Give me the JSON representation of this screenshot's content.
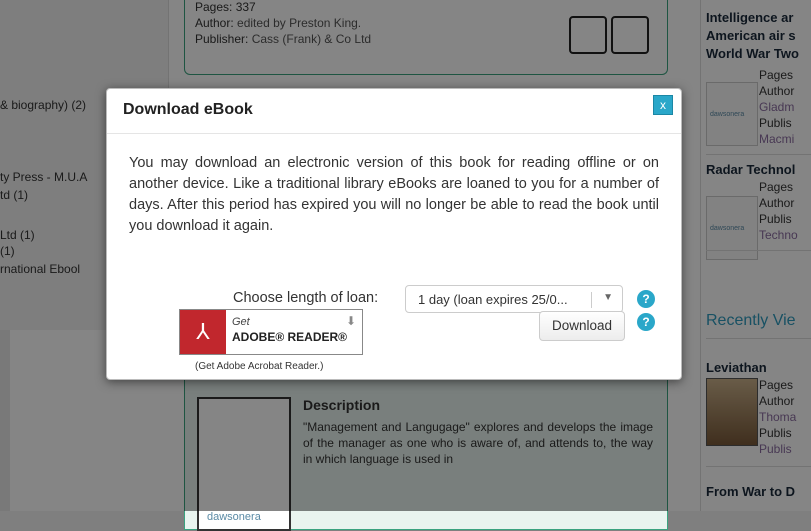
{
  "left_sidebar": {
    "items": [
      "& biography) (2)",
      "ty Press - M.U.A",
      "td (1)",
      "Ltd (1)",
      "(1)",
      "rnational Ebool"
    ]
  },
  "center_book": {
    "pages": "Pages: 337",
    "author_label": "Author:",
    "author": "edited by Preston King.",
    "publisher_label": "Publisher:",
    "publisher": "Cass (Frank) & Co Ltd"
  },
  "description_card": {
    "title": "Description",
    "text": "\"Management and Langugage\" explores and develops the image of the manager as one who is aware of, and attends to, the way in which language is used in",
    "cover_logo": "dawsonera"
  },
  "right_column": {
    "book1_title_lines": [
      "Intelligence ar",
      "American air s",
      "World War Two"
    ],
    "book1_meta": [
      "Pages",
      "Author",
      "Gladm",
      "Publis",
      "Macmi"
    ],
    "book2_title": "Radar Technol",
    "book2_meta": [
      "Pages",
      "Author",
      "Publis",
      "Techno"
    ],
    "recently_viewed": "Recently Vie",
    "book3_title": "Leviathan",
    "book3_meta": [
      "Pages",
      "Author",
      "Thoma",
      "Publis",
      "Publis"
    ],
    "book4_title": "From War to D",
    "thumb_logo": "dawsonera"
  },
  "modal": {
    "title": "Download eBook",
    "close_label": "x",
    "body": "You may download an electronic version of this book for reading offline or on another device. Like a traditional library eBooks are loaned to you for a number of days. After this period has expired you will no longer be able to read the book until you download it again.",
    "loan_label": "Choose length of loan:",
    "loan_selected": "1 day (loan expires 25/0...",
    "help_icon": "?",
    "adobe_get": "Get",
    "adobe_name": "ADOBE® READER®",
    "adobe_caption": "(Get Adobe Acrobat Reader.)",
    "download_label": "Download"
  },
  "colors": {
    "accent": "#2aa7c9",
    "card_border": "#3aa37f",
    "adobe_red": "#c1272d"
  }
}
